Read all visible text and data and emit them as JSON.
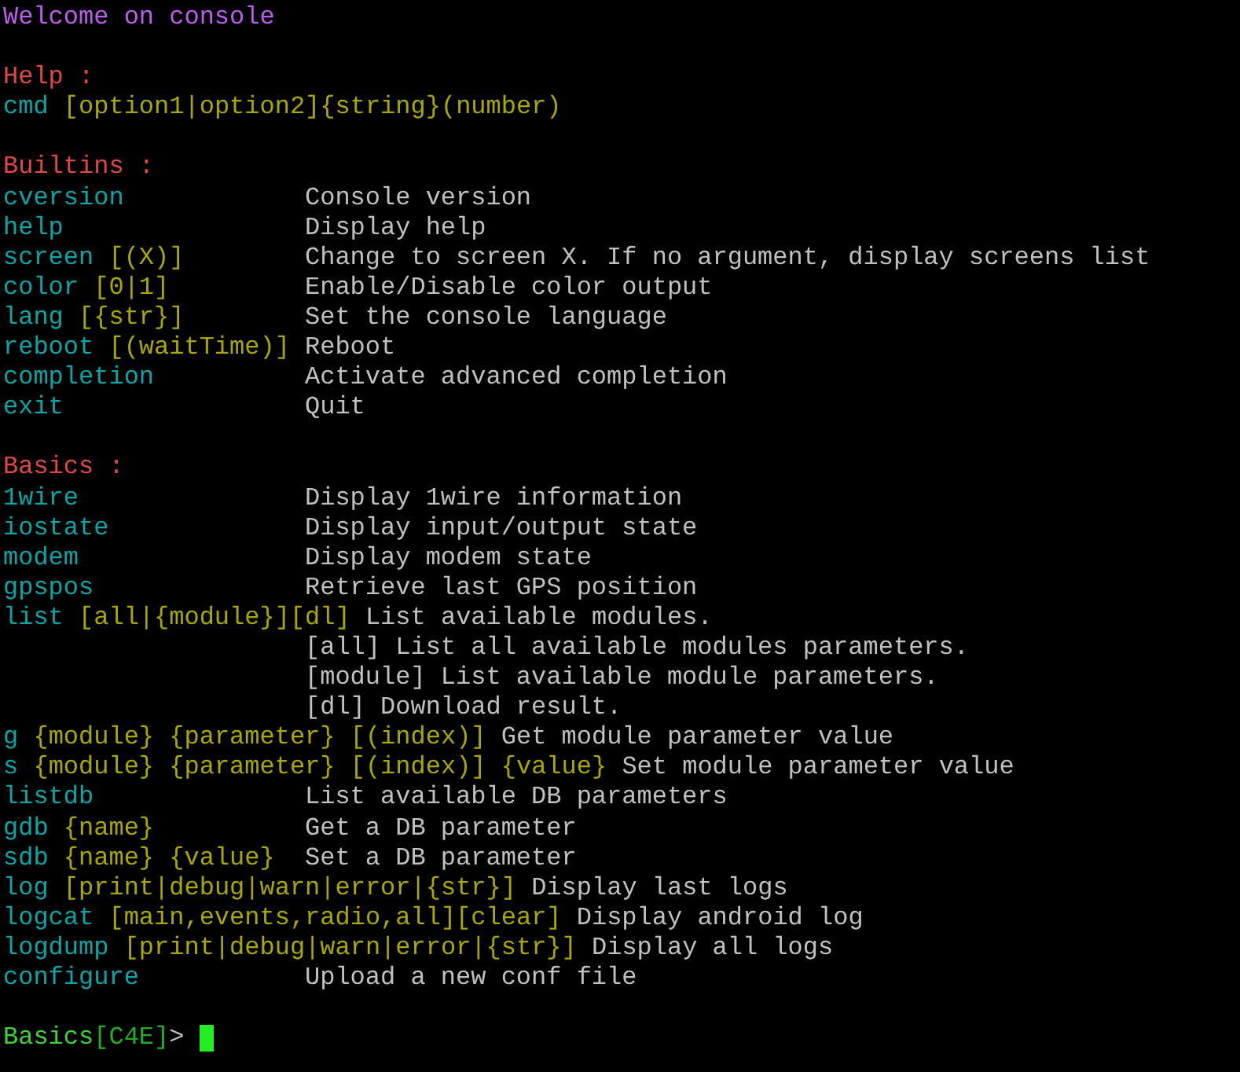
{
  "lines": [
    {
      "kind": "banner",
      "text": "Welcome on console"
    },
    {
      "kind": "gap"
    },
    {
      "kind": "heading",
      "text": "Help :"
    },
    {
      "kind": "entry",
      "command": "cmd",
      "args": "[option1|option2]{string}(number)"
    },
    {
      "kind": "gap"
    },
    {
      "kind": "heading",
      "text": "Builtins :"
    },
    {
      "kind": "entry",
      "command": "cversion",
      "description": "Console version",
      "aligned": true
    },
    {
      "kind": "entry",
      "command": "help",
      "description": "Display help",
      "aligned": true
    },
    {
      "kind": "entry",
      "command": "screen",
      "args": "[(X)]",
      "description": "Change to screen X. If no argument, display screens list",
      "aligned": true
    },
    {
      "kind": "entry",
      "command": "color",
      "args": "[0|1]",
      "description": "Enable/Disable color output",
      "aligned": true
    },
    {
      "kind": "entry",
      "command": "lang",
      "args": "[{str}]",
      "description": "Set the console language",
      "aligned": true
    },
    {
      "kind": "entry",
      "command": "reboot",
      "args": "[(waitTime)]",
      "description": "Reboot",
      "aligned": true
    },
    {
      "kind": "entry",
      "command": "completion",
      "description": "Activate advanced completion",
      "aligned": true
    },
    {
      "kind": "entry",
      "command": "exit",
      "description": "Quit",
      "aligned": true
    },
    {
      "kind": "gap"
    },
    {
      "kind": "heading",
      "text": "Basics :"
    },
    {
      "kind": "entry",
      "command": "1wire",
      "description": "Display 1wire information",
      "aligned": true
    },
    {
      "kind": "entry",
      "command": "iostate",
      "description": "Display input/output state",
      "aligned": true
    },
    {
      "kind": "entry",
      "command": "modem",
      "description": "Display modem state",
      "aligned": true
    },
    {
      "kind": "entry",
      "command": "gpspos",
      "description": "Retrieve last GPS position",
      "aligned": true
    },
    {
      "kind": "entry",
      "command": "list",
      "args": "[all|{module}][dl]",
      "description": "List available modules.",
      "aligned": false
    },
    {
      "kind": "continuation",
      "text": "[all] List all available modules parameters."
    },
    {
      "kind": "continuation",
      "text": "[module] List available module parameters."
    },
    {
      "kind": "continuation",
      "text": "[dl] Download result."
    },
    {
      "kind": "entry",
      "command": "g",
      "args": "{module} {parameter} [(index)]",
      "description": "Get module parameter value",
      "aligned": false
    },
    {
      "kind": "entry",
      "command": "s",
      "args": "{module} {parameter} [(index)] {value}",
      "description": "Set module parameter value",
      "aligned": false
    },
    {
      "kind": "entry",
      "command": "listdb",
      "description": "List available DB parameters",
      "aligned": true
    },
    {
      "kind": "entry",
      "command": "gdb",
      "args": "{name}",
      "description": "Get a DB parameter",
      "aligned": true
    },
    {
      "kind": "entry",
      "command": "sdb",
      "args": "{name} {value}",
      "description": "Set a DB parameter",
      "aligned": true
    },
    {
      "kind": "entry",
      "command": "log",
      "args": "[print|debug|warn|error|{str}]",
      "description": "Display last logs",
      "aligned": false
    },
    {
      "kind": "entry",
      "command": "logcat",
      "args": "[main,events,radio,all][clear]",
      "description": "Display android log",
      "aligned": false
    },
    {
      "kind": "entry",
      "command": "logdump",
      "args": "[print|debug|warn|error|{str}]",
      "description": "Display all logs",
      "aligned": false
    },
    {
      "kind": "entry",
      "command": "configure",
      "description": "Upload a new conf file",
      "aligned": true
    },
    {
      "kind": "gap"
    }
  ],
  "prompt": {
    "mode": "Basics",
    "device": "[C4E]",
    "symbol": ">"
  }
}
